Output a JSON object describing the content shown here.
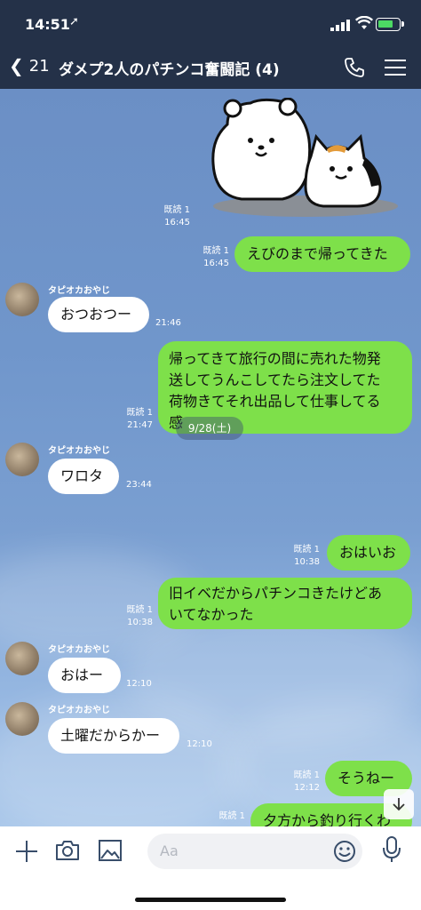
{
  "status_bar": {
    "time": "14:51",
    "location_glyph": "➚"
  },
  "header": {
    "back_glyph": "❮",
    "back_count": "21",
    "title": "ダメプ2人のパチンコ奮闘記 (4)",
    "icons": [
      "phone-icon",
      "hamburger-menu-icon"
    ]
  },
  "messages": [
    {
      "type": "sticker",
      "read": "既読 1",
      "time": "16:45"
    },
    {
      "type": "out",
      "text": "えびのまで帰ってきた",
      "read": "既読 1",
      "time": "16:45"
    },
    {
      "type": "in",
      "sender": "タピオカおやじ",
      "text": "おつおつー",
      "time": "21:46"
    },
    {
      "type": "out",
      "text": "帰ってきて旅行の間に売れた物発送してうんこしてたら注文してた荷物きてそれ出品して仕事してる感",
      "lines": [
        "帰ってきて旅行の間に売れた物発",
        "送してうんこしてたら注文してた",
        "荷物きてそれ出品して仕事してる",
        "感"
      ],
      "read": "既読 1",
      "time": "21:47"
    },
    {
      "type": "in",
      "sender": "タピオカおやじ",
      "text": "ワロタ",
      "time": "23:44"
    },
    {
      "type": "date",
      "text": "9/28(土)"
    },
    {
      "type": "out",
      "text": "おはいお",
      "read": "既読 1",
      "time": "10:38"
    },
    {
      "type": "out",
      "text": "旧イベだからパチンコきたけどあいてなかった",
      "lines": [
        "旧イベだからパチンコきたけどあ",
        "いてなかった"
      ],
      "read": "既読 1",
      "time": "10:38"
    },
    {
      "type": "in",
      "sender": "タピオカおやじ",
      "text": "おはー",
      "time": "12:10"
    },
    {
      "type": "in",
      "sender": "タピオカおやじ",
      "text": "土曜だからかー",
      "time": "12:10"
    },
    {
      "type": "out",
      "text": "そうねー",
      "read": "既読 1",
      "time": "12:12"
    },
    {
      "type": "out",
      "text": "夕方から釣り行くわ",
      "read": "既読 1",
      "time": ""
    }
  ],
  "footer": {
    "placeholder": "Aa",
    "icons": [
      "plus-icon",
      "camera-icon",
      "image-icon",
      "emoji-icon",
      "microphone-icon"
    ]
  },
  "colors": {
    "header_bg": "#243148",
    "out_bubble": "#7ee04a",
    "in_bubble": "#ffffff",
    "chat_bg": "#6f92c7"
  }
}
